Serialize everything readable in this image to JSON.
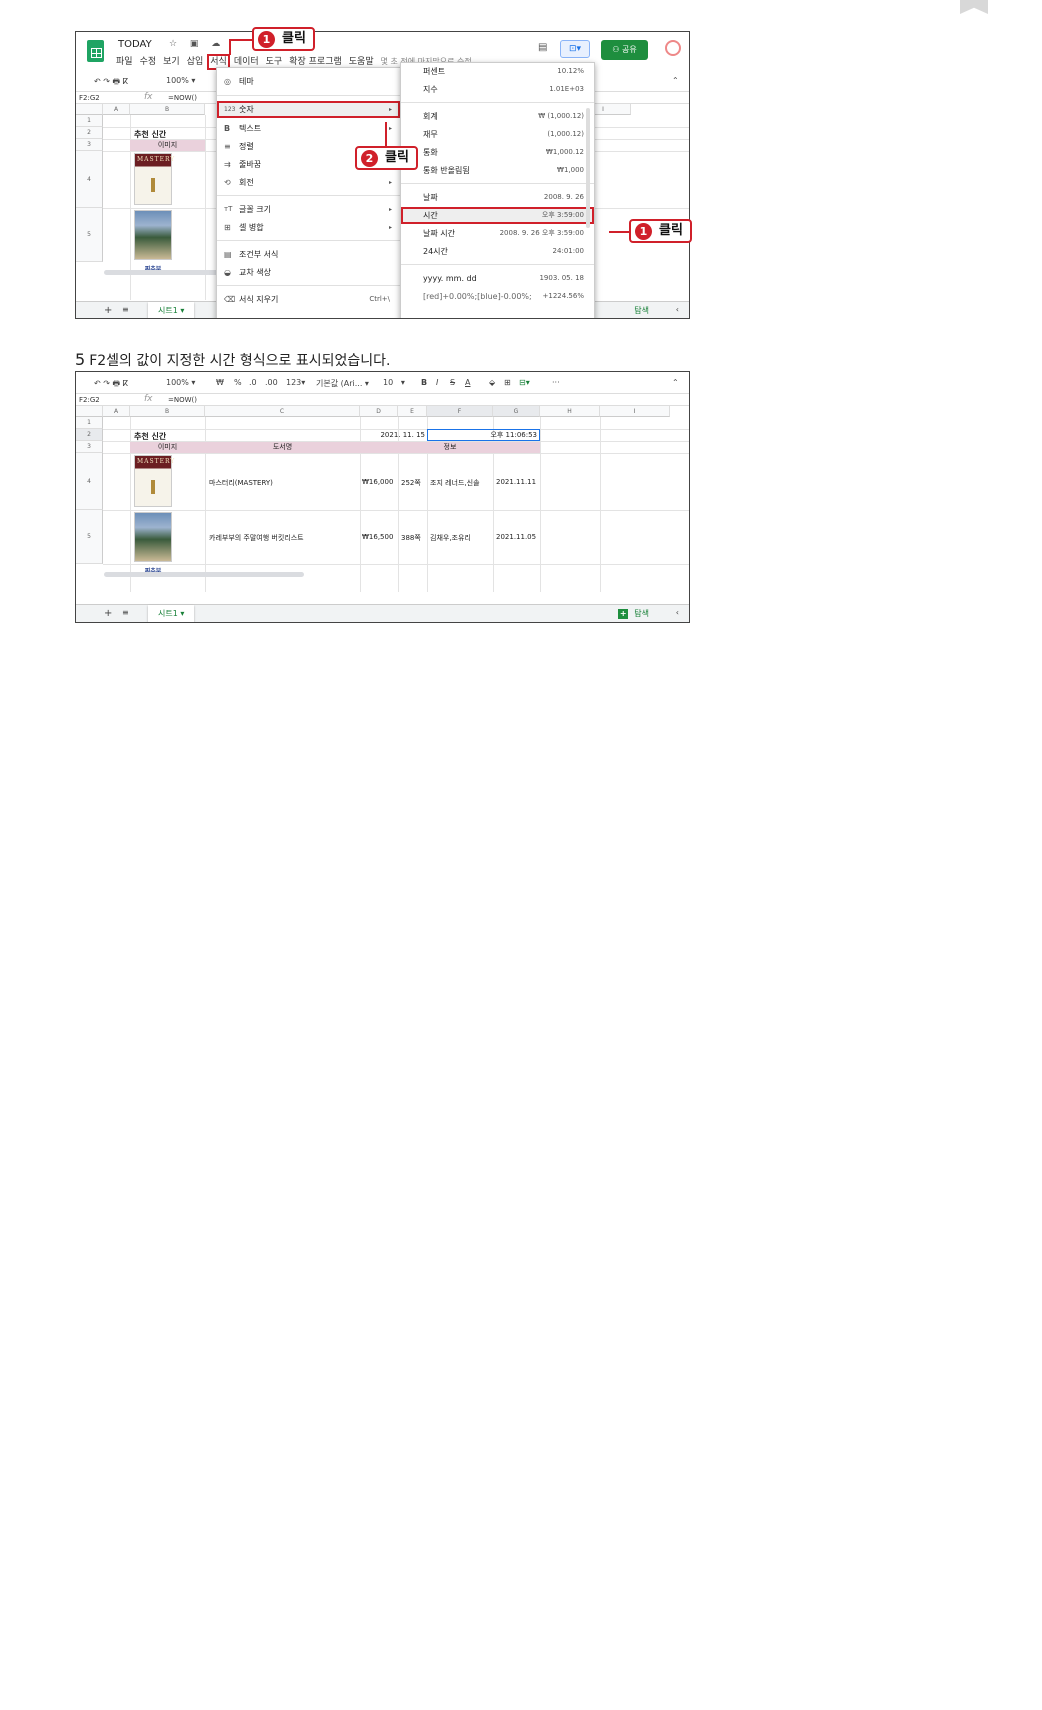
{
  "doc": {
    "title": "TODAY",
    "title_icons": "☆ ▣ ☁"
  },
  "menubar": {
    "items": [
      "파일",
      "수정",
      "보기",
      "삽입",
      "서식",
      "데이터",
      "도구",
      "확장 프로그램",
      "도움말"
    ],
    "last_edit": "몇 초 전에 마지막으로 수정..."
  },
  "share_label": "공유",
  "toolbar1": {
    "icons": "↶ ↷ 🖶 ⴽ",
    "zoom": "100%"
  },
  "toolbar2": {
    "icons": "↶ ↷ 🖶 ⴽ",
    "zoom": "100%",
    "currency": "₩",
    "percent": "%",
    "dec_less": ".0",
    "dec_more": ".00",
    "num_fmt": "123",
    "font": "기본값 (Ari...",
    "size": "10",
    "bold": "B",
    "italic": "I",
    "strike": "S",
    "color": "A",
    "more": "···"
  },
  "formula": {
    "namebox": "F2:G2",
    "fx": "fx",
    "value": "=NOW()"
  },
  "columns1": [
    "A",
    "B",
    "I"
  ],
  "columns2": [
    "A",
    "B",
    "C",
    "D",
    "E",
    "F",
    "G",
    "H",
    "I"
  ],
  "rows": [
    "1",
    "2",
    "3",
    "4",
    "5"
  ],
  "sheet": {
    "title_cell": "추천 신간",
    "header_image": "이미지",
    "header_title": "도서명",
    "header_info": "정보",
    "date_cell": "2021. 11. 15",
    "time_cell": "오후 11:06:53",
    "book1": {
      "title": "마스터리(MASTERY)",
      "price": "₩16,000",
      "pages": "252쪽",
      "author": "조지 레너드,신솔",
      "date": "2021.11.11"
    },
    "book2": {
      "title": "카레부부의 주말여행 버킷리스트",
      "price": "₩16,500",
      "pages": "388쪽",
      "author": "김채우,조유리",
      "date": "2021.11.05"
    },
    "book1_cover": "MASTERY",
    "book3_cover": "찌추부"
  },
  "format_menu": [
    {
      "icon": "◎",
      "label": "테마"
    },
    {
      "icon": "123",
      "label": "숫자",
      "arrow": "▸"
    },
    {
      "icon": "B",
      "label": "텍스트",
      "arrow": "▸"
    },
    {
      "icon": "≡",
      "label": "정렬"
    },
    {
      "icon": "⇉",
      "label": "줄바꿈"
    },
    {
      "icon": "⟲",
      "label": "회전",
      "arrow": "▸"
    },
    {
      "icon": "тT",
      "label": "글꼴 크기",
      "arrow": "▸"
    },
    {
      "icon": "⊞",
      "label": "셀 병합",
      "arrow": "▸"
    },
    {
      "icon": "▤",
      "label": "조건부 서식"
    },
    {
      "icon": "◒",
      "label": "교차 색상"
    },
    {
      "icon": "⌫",
      "label": "서식 지우기",
      "shortcut": "Ctrl+\\"
    }
  ],
  "number_menu": [
    {
      "label": "퍼센트",
      "value": "10.12%"
    },
    {
      "label": "지수",
      "value": "1.01E+03"
    },
    {
      "label": "회계",
      "value": "₩ (1,000.12)"
    },
    {
      "label": "재무",
      "value": "(1,000.12)"
    },
    {
      "label": "통화",
      "value": "₩1,000.12"
    },
    {
      "label": "통화 반올림됨",
      "value": "₩1,000"
    },
    {
      "label": "날짜",
      "value": "2008. 9. 26"
    },
    {
      "label": "시간",
      "value": "오후 3:59:00"
    },
    {
      "label": "날짜 시간",
      "value": "2008. 9. 26 오후 3:59:00"
    },
    {
      "label": "24시간",
      "value": "24:01:00"
    },
    {
      "label": "yyyy. mm. dd",
      "value": "1903. 05. 18"
    },
    {
      "label": "[red]+0.00%;[blue]-0.00%;",
      "value": "+1224.56%"
    }
  ],
  "callouts": {
    "c1": {
      "num": "1",
      "text": "클릭"
    },
    "c2": {
      "num": "2",
      "text": "클릭"
    },
    "c3": {
      "num": "1",
      "text": "클릭"
    }
  },
  "tabbar": {
    "plus": "+",
    "list": "≡",
    "tab": "시트1 ▾",
    "explore": "탐색",
    "chev": "‹"
  },
  "caption": {
    "step": "5",
    "text": "F2셀의 값이 지정한 시간 형식으로 표시되었습니다."
  },
  "colors": {
    "accent_red": "#d0202a",
    "sheets_green": "#1e8e3e"
  }
}
